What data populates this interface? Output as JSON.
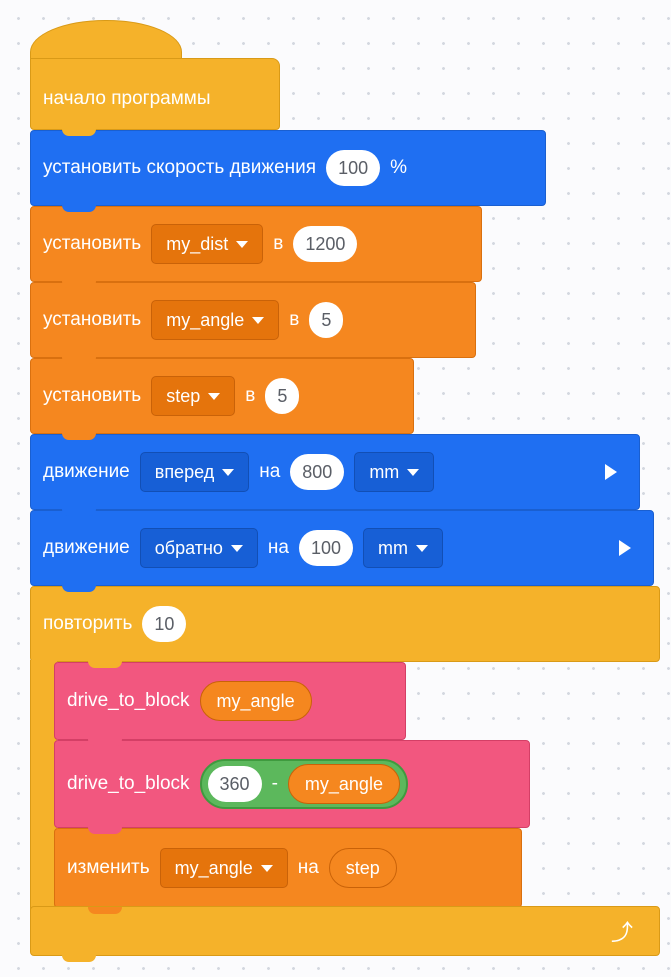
{
  "blocks": {
    "start": {
      "label": "начало программы"
    },
    "set_speed": {
      "label": "установить скорость движения",
      "value": "100",
      "unit": "%"
    },
    "set_dist": {
      "label": "установить",
      "variable": "my_dist",
      "preposition": "в",
      "value": "1200"
    },
    "set_angle": {
      "label": "установить",
      "variable": "my_angle",
      "preposition": "в",
      "value": "5"
    },
    "set_step": {
      "label": "установить",
      "variable": "step",
      "preposition": "в",
      "value": "5"
    },
    "move_forward": {
      "label": "движение",
      "direction": "вперед",
      "preposition": "на",
      "value": "800",
      "unit": "mm"
    },
    "move_back": {
      "label": "движение",
      "direction": "обратно",
      "preposition": "на",
      "value": "100",
      "unit": "mm"
    },
    "repeat": {
      "label": "повторить",
      "value": "10"
    },
    "drive1": {
      "label": "drive_to_block",
      "arg": "my_angle"
    },
    "drive2": {
      "label": "drive_to_block",
      "left": "360",
      "operator": "-",
      "right": "my_angle"
    },
    "change": {
      "label": "изменить",
      "variable": "my_angle",
      "preposition": "на",
      "value": "step"
    }
  },
  "icons": {
    "dropdown": "chevron-down-icon",
    "run": "play-icon",
    "loop": "loop-arrow-icon"
  },
  "colors": {
    "events": "#f5b22a",
    "motion": "#1f6ff2",
    "variables": "#f5871f",
    "control": "#f5b22a",
    "custom": "#f2577f",
    "operators": "#5cb85c"
  }
}
